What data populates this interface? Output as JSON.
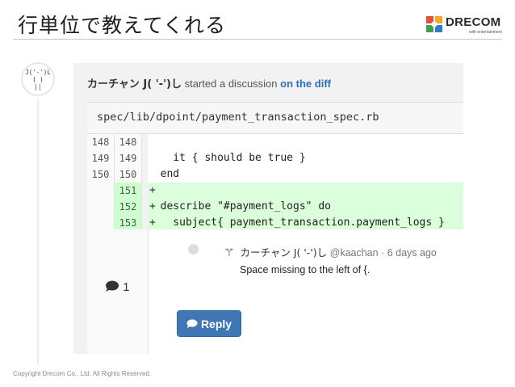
{
  "slide": {
    "title": "行単位で教えてくれる",
    "logo_text": "DRECOM",
    "logo_sub": "with entertainment",
    "copyright": "Copyright Drecom Co., Ltd. All Rights Reserved."
  },
  "avatar": {
    "icon": "ascii-face-avatar",
    "art": "J('-')L\n( )\n||"
  },
  "discussion": {
    "author": "カーチャン J( '-')し",
    "action": "started a discussion",
    "link": "on the diff",
    "file": "spec/lib/dpoint/payment_transaction_spec.rb",
    "lines": [
      {
        "old": "148",
        "new": "148",
        "mark": "",
        "code": "",
        "added": false
      },
      {
        "old": "149",
        "new": "149",
        "mark": "",
        "code": "    it { should be true }",
        "added": false
      },
      {
        "old": "150",
        "new": "150",
        "mark": "",
        "code": "  end",
        "added": false
      },
      {
        "old": "",
        "new": "151",
        "mark": "+",
        "code": "",
        "added": true
      },
      {
        "old": "",
        "new": "152",
        "mark": "+",
        "code": "  describe \"#payment_logs\" do",
        "added": true
      },
      {
        "old": "",
        "new": "153",
        "mark": "+",
        "code": "    subject{ payment_transaction.payment_logs }",
        "added": true
      }
    ],
    "note_count": "1",
    "note": {
      "author": "カーチャン J( '-')し",
      "handle": "@kaachan",
      "time": "· 6 days ago",
      "body": "Space missing to the left of {."
    },
    "reply_label": "Reply"
  },
  "colors": {
    "accent": "#3e77b3",
    "link": "#2c6eb8",
    "added_bg": "#dbffdb"
  }
}
